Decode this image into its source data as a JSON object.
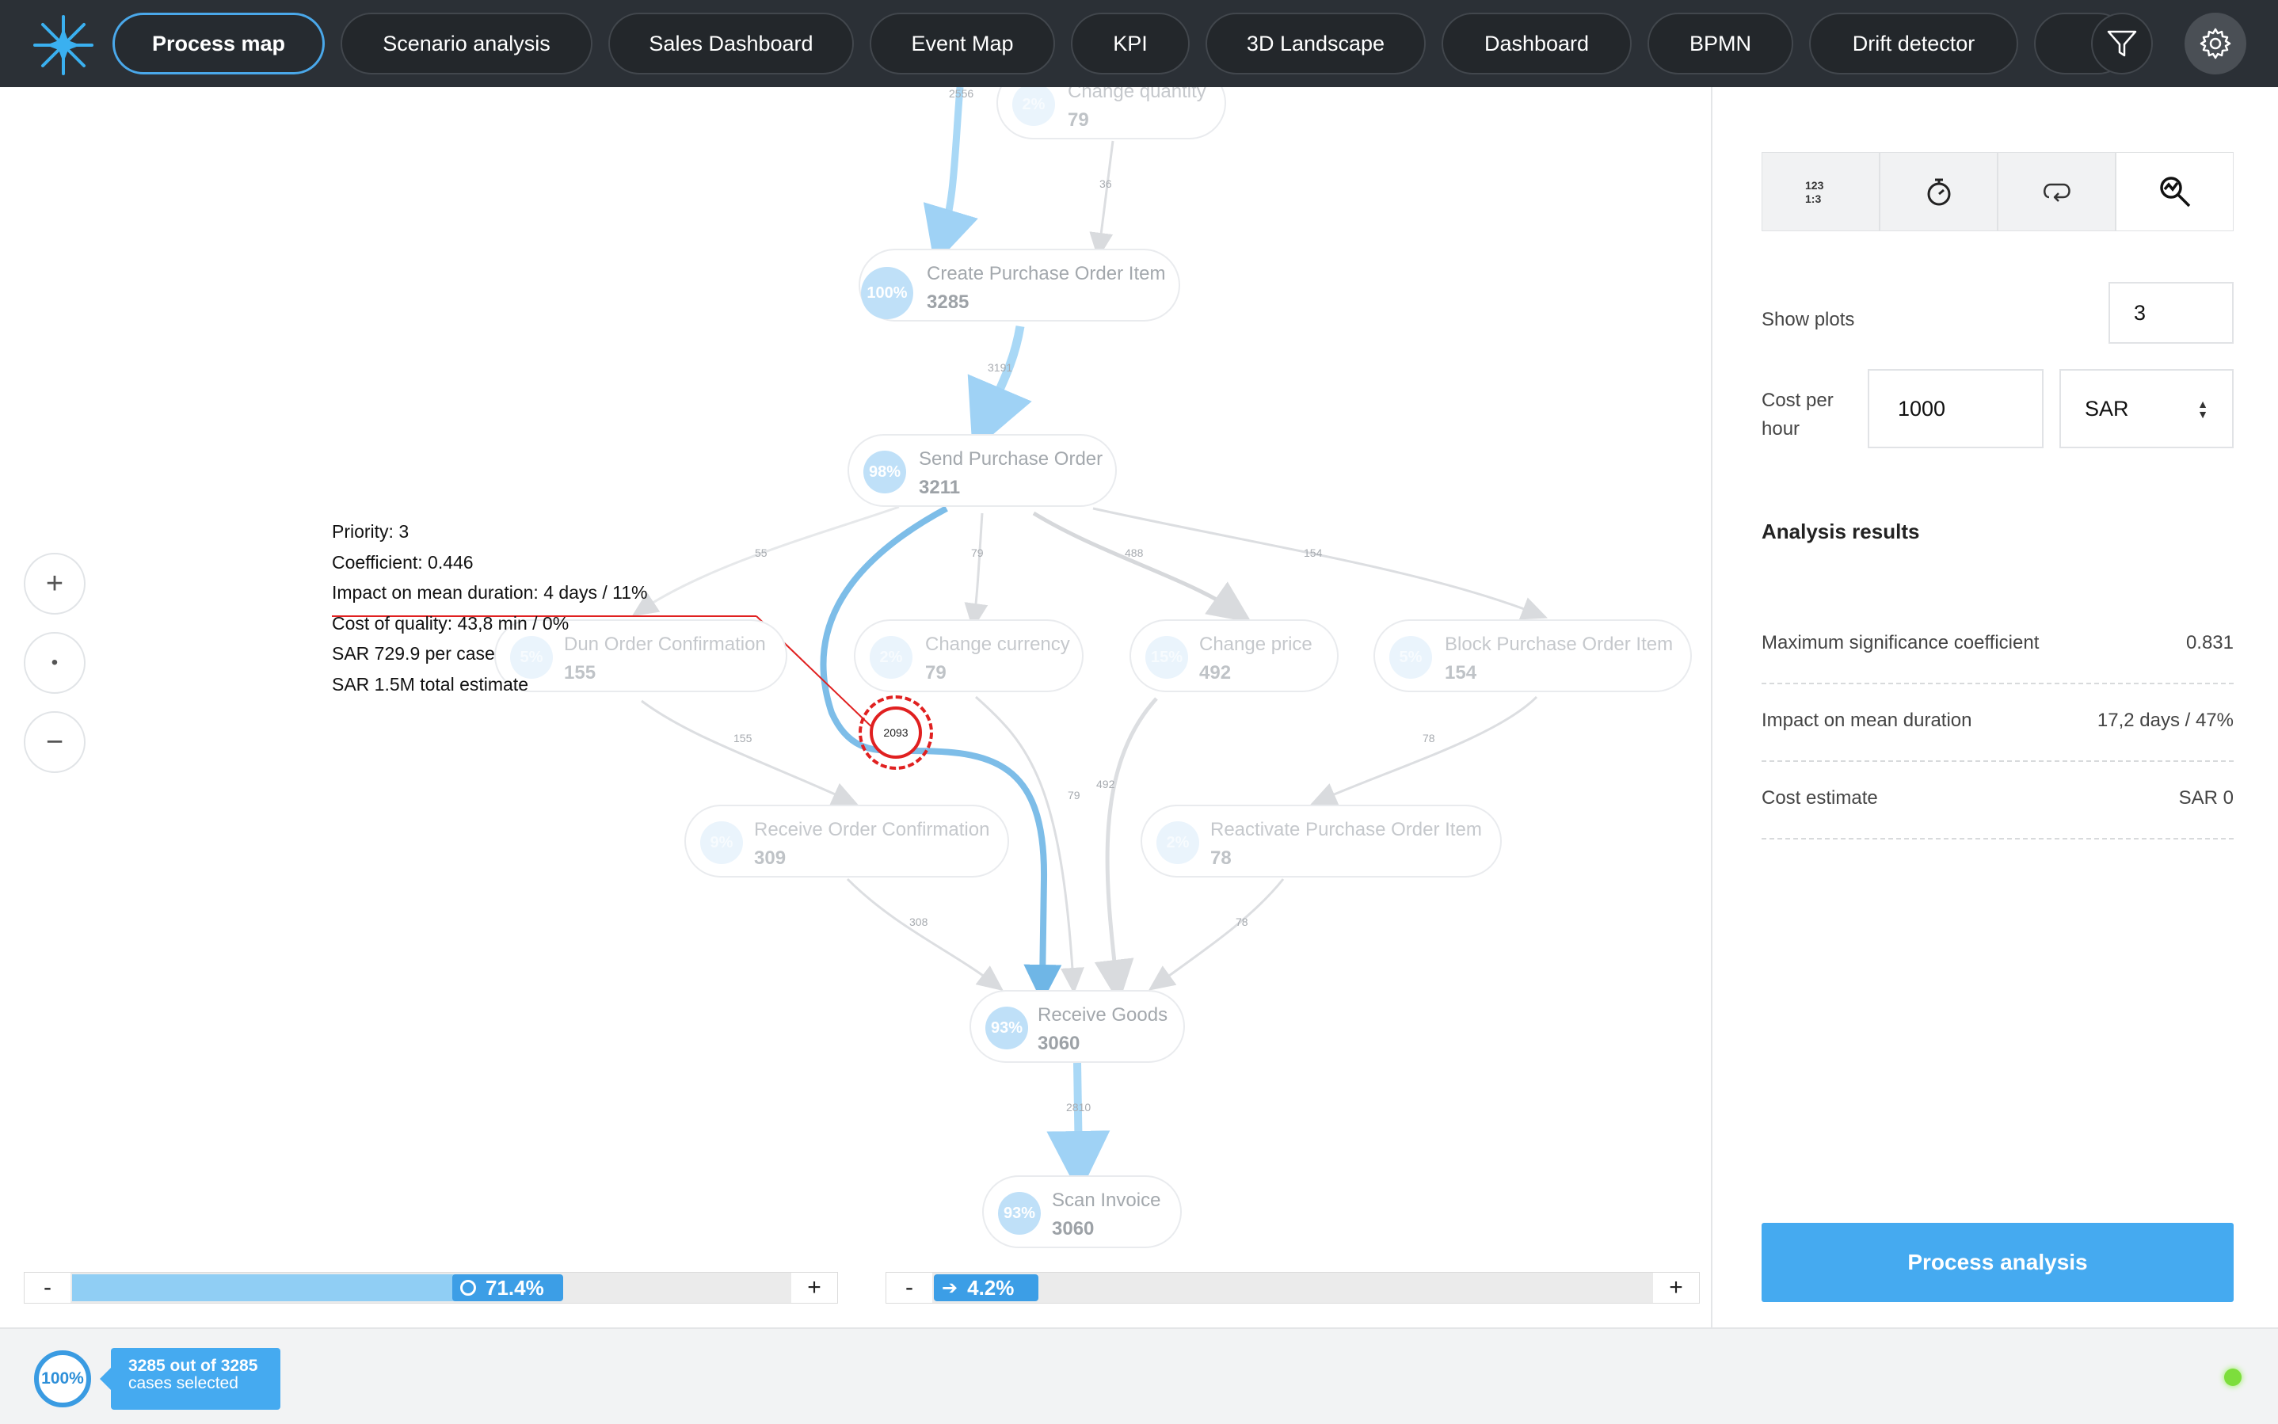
{
  "nav": {
    "tabs": [
      {
        "label": "Process map",
        "active": true
      },
      {
        "label": "Scenario analysis",
        "active": false
      },
      {
        "label": "Sales Dashboard",
        "active": false
      },
      {
        "label": "Event Map",
        "active": false
      },
      {
        "label": "KPI",
        "active": false
      },
      {
        "label": "3D Landscape",
        "active": false
      },
      {
        "label": "Dashboard",
        "active": false
      },
      {
        "label": "BPMN",
        "active": false
      },
      {
        "label": "Drift detector",
        "active": false
      }
    ],
    "icons": {
      "logo": "star-logo-icon",
      "filter": "filter-icon",
      "settings": "gear-icon"
    }
  },
  "process_map": {
    "nodes": [
      {
        "id": "change-quantity",
        "name": "Change quantity",
        "pct": "2%",
        "count": "79",
        "faded": true
      },
      {
        "id": "create-po-item",
        "name": "Create Purchase Order Item",
        "pct": "100%",
        "count": "3285",
        "faded": false
      },
      {
        "id": "send-po",
        "name": "Send Purchase Order",
        "pct": "98%",
        "count": "3211",
        "faded": false
      },
      {
        "id": "dun-order",
        "name": "Dun Order Confirmation",
        "pct": "5%",
        "count": "155",
        "faded": true
      },
      {
        "id": "change-currency",
        "name": "Change currency",
        "pct": "2%",
        "count": "79",
        "faded": true
      },
      {
        "id": "change-price",
        "name": "Change price",
        "pct": "15%",
        "count": "492",
        "faded": true
      },
      {
        "id": "block-po-item",
        "name": "Block Purchase Order Item",
        "pct": "5%",
        "count": "154",
        "faded": true
      },
      {
        "id": "receive-order-conf",
        "name": "Receive Order Confirmation",
        "pct": "9%",
        "count": "309",
        "faded": true
      },
      {
        "id": "reactivate-po-item",
        "name": "Reactivate Purchase Order Item",
        "pct": "2%",
        "count": "78",
        "faded": true
      },
      {
        "id": "receive-goods",
        "name": "Receive Goods",
        "pct": "93%",
        "count": "3060",
        "faded": false
      },
      {
        "id": "scan-invoice",
        "name": "Scan Invoice",
        "pct": "93%",
        "count": "3060",
        "faded": false
      }
    ],
    "edge_labels": [
      "2556",
      "36",
      "3191",
      "55",
      "79",
      "488",
      "154",
      "155",
      "79",
      "492",
      "78",
      "308",
      "78",
      "2810"
    ],
    "highlight_edge_label": "2093",
    "zoom": {
      "in": "+",
      "reset": "•",
      "out": "−"
    },
    "tooltip": [
      "Priority: 3",
      "Coefficient: 0.446",
      "Impact on mean duration: 4 days / 11%",
      "Cost of quality: 43,8 min / 0%",
      "SAR 729.9 per case",
      "SAR 1.5M total estimate"
    ],
    "activities_slider": {
      "minus": "-",
      "plus": "+",
      "value": "71.4%",
      "fraction": 0.714
    },
    "paths_slider": {
      "minus": "-",
      "plus": "+",
      "value": "4.2%",
      "fraction": 0.042
    }
  },
  "panel": {
    "mode_icons": [
      "numbers-icon",
      "stopwatch-icon",
      "loop-icon",
      "zoom-analysis-icon"
    ],
    "show_plots": {
      "label": "Show plots",
      "value": "3"
    },
    "cost_per_hour": {
      "label_1": "Cost per",
      "label_2": "hour",
      "value": "1000",
      "currency": "SAR"
    },
    "results_title": "Analysis results",
    "results": [
      {
        "key": "Maximum significance coefficient",
        "value": "0.831"
      },
      {
        "key": "Impact on mean duration",
        "value": "17,2 days / 47%"
      },
      {
        "key": "Cost estimate",
        "value": "SAR 0"
      }
    ],
    "analysis_button": "Process analysis"
  },
  "footer": {
    "cases_pct": "100%",
    "cases_line1": "3285 out of 3285",
    "cases_line2": "cases selected",
    "status_color": "#7dde3c"
  },
  "colors": {
    "accent": "#45aaf0",
    "nav_bg": "#2b3036",
    "highlight": "#e02020"
  }
}
